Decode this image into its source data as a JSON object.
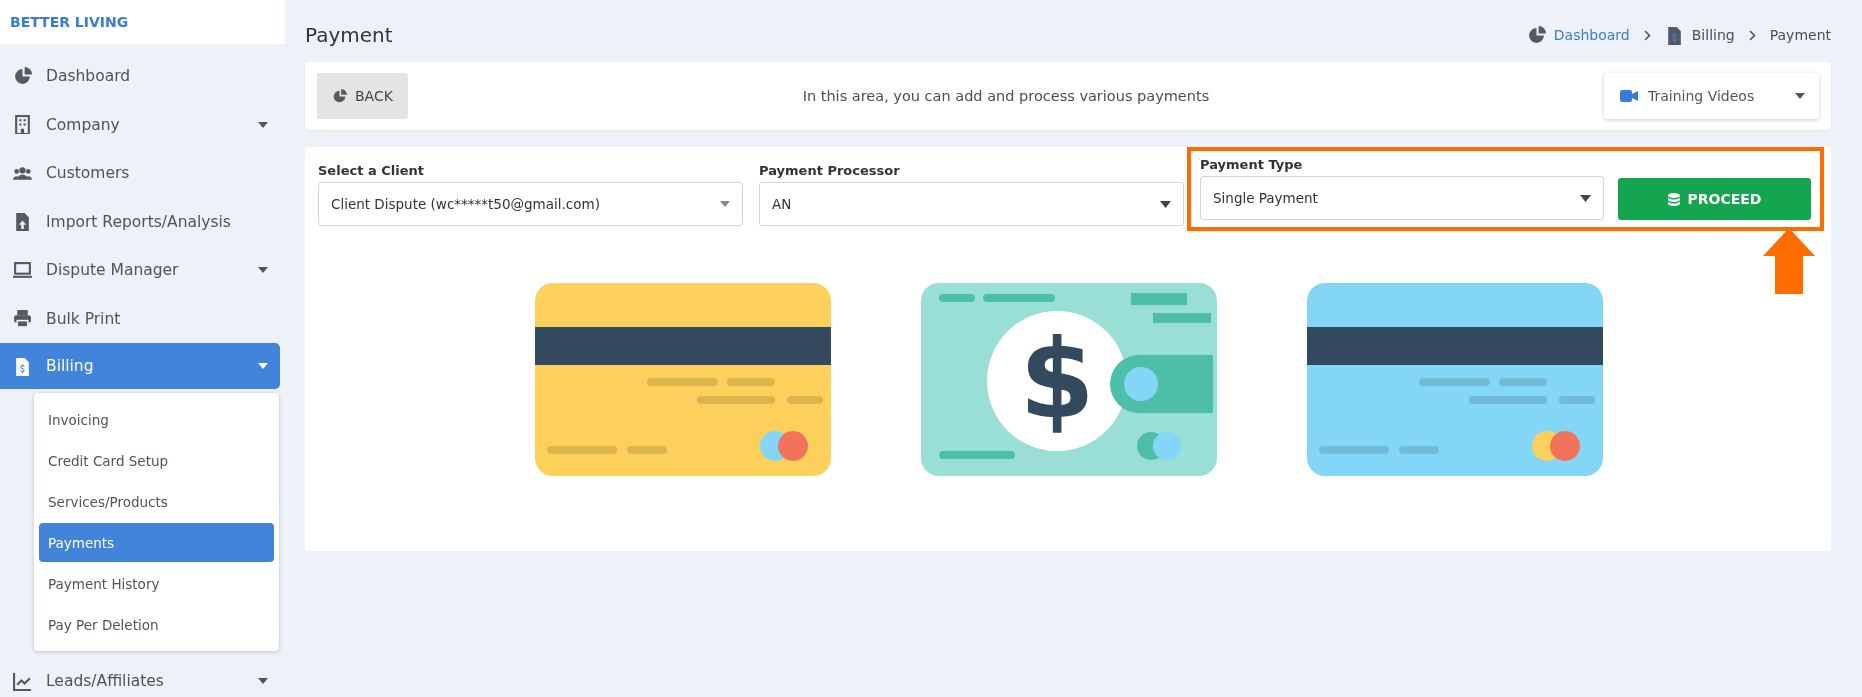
{
  "brand": "BETTER LIVING",
  "sidebar": {
    "items": [
      {
        "label": "Dashboard",
        "has_caret": false,
        "selected": false
      },
      {
        "label": "Company",
        "has_caret": true,
        "selected": false
      },
      {
        "label": "Customers",
        "has_caret": false,
        "selected": false
      },
      {
        "label": "Import Reports/Analysis",
        "has_caret": false,
        "selected": false
      },
      {
        "label": "Dispute Manager",
        "has_caret": true,
        "selected": false
      },
      {
        "label": "Bulk Print",
        "has_caret": false,
        "selected": false
      },
      {
        "label": "Billing",
        "has_caret": true,
        "selected": true,
        "expanded": true,
        "children": [
          {
            "label": "Invoicing",
            "selected": false
          },
          {
            "label": "Credit Card Setup",
            "selected": false
          },
          {
            "label": "Services/Products",
            "selected": false
          },
          {
            "label": "Payments",
            "selected": true
          },
          {
            "label": "Payment History",
            "selected": false
          },
          {
            "label": "Pay Per Deletion",
            "selected": false
          }
        ]
      },
      {
        "label": "Leads/Affiliates",
        "has_caret": true,
        "selected": false
      }
    ]
  },
  "page_title": "Payment",
  "breadcrumb": [
    {
      "label": "Dashboard",
      "link": true
    },
    {
      "label": "Billing",
      "link": false
    },
    {
      "label": "Payment",
      "link": false
    }
  ],
  "toolbar": {
    "back_button": "BACK",
    "info": "In this area, you can add and process various payments",
    "training_videos": "Training Videos"
  },
  "form": {
    "fields": [
      {
        "label": "Select a Client",
        "value": "Client Dispute (wc*****t50@gmail.com)",
        "highlighted": false
      },
      {
        "label": "Payment Processor",
        "value": "AN",
        "highlighted": false
      },
      {
        "label": "Payment Type",
        "value": "Single Payment",
        "highlighted": true
      }
    ],
    "proceed_button": "PROCEED"
  },
  "illustrations": [
    {
      "kind": "card",
      "color": "#fdd05b"
    },
    {
      "kind": "cash",
      "symbol": "$"
    },
    {
      "kind": "card",
      "color": "#84d6f6"
    }
  ]
}
